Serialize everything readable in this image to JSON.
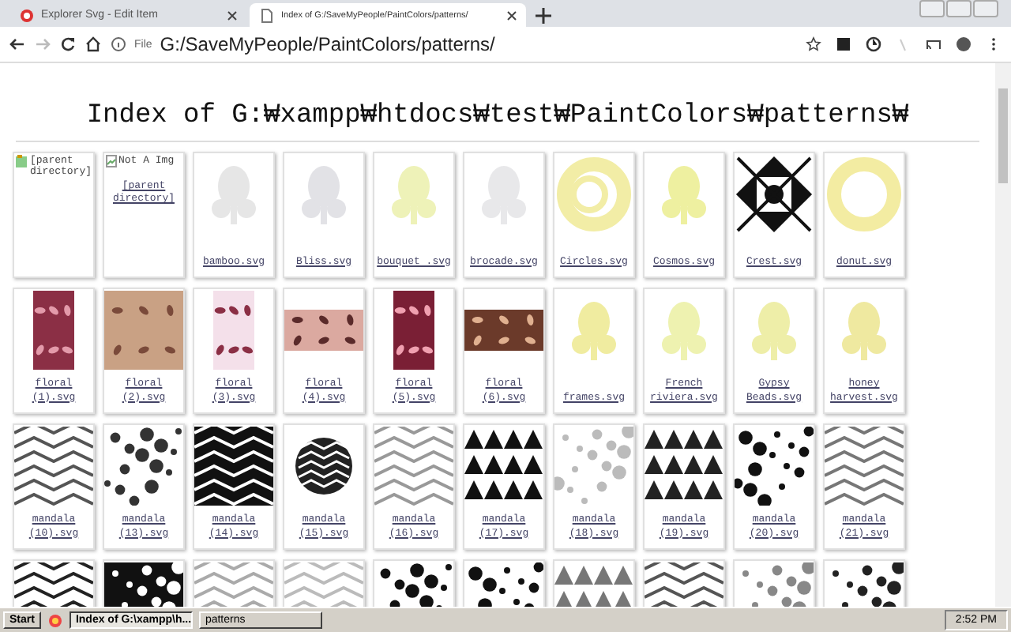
{
  "tabs": [
    {
      "title": "Explorer Svg - Edit Item",
      "selected": false
    },
    {
      "title": "Index of G:/SaveMyPeople/PaintColors/patterns/",
      "selected": true
    }
  ],
  "address_bar": {
    "chip": "File",
    "url": "G:/SaveMyPeople/PaintColors/patterns/"
  },
  "page": {
    "heading": "Index of G:₩xampp₩htdocs₩test₩PaintColors₩patterns₩",
    "items": [
      {
        "kind": "folder",
        "label": "[parent directory]"
      },
      {
        "kind": "broken",
        "alt": "Not A Img",
        "label": "[parent directory]"
      },
      {
        "kind": "file",
        "label": "bamboo.svg"
      },
      {
        "kind": "file",
        "label": "Bliss.svg"
      },
      {
        "kind": "file",
        "label": "bouquet .svg"
      },
      {
        "kind": "file",
        "label": "brocade.svg"
      },
      {
        "kind": "file",
        "label": "Circles.svg"
      },
      {
        "kind": "file",
        "label": "Cosmos.svg"
      },
      {
        "kind": "file",
        "label": "Crest.svg"
      },
      {
        "kind": "file",
        "label": "donut.svg"
      },
      {
        "kind": "file",
        "label": "floral (1).svg"
      },
      {
        "kind": "file",
        "label": "floral (2).svg"
      },
      {
        "kind": "file",
        "label": "floral (3).svg"
      },
      {
        "kind": "file",
        "label": "floral (4).svg"
      },
      {
        "kind": "file",
        "label": "floral (5).svg"
      },
      {
        "kind": "file",
        "label": "floral (6).svg"
      },
      {
        "kind": "file",
        "label": "frames.svg"
      },
      {
        "kind": "file",
        "label": "French riviera.svg"
      },
      {
        "kind": "file",
        "label": "Gypsy Beads.svg"
      },
      {
        "kind": "file",
        "label": "honey harvest.svg"
      },
      {
        "kind": "file",
        "label": "mandala (10).svg"
      },
      {
        "kind": "file",
        "label": "mandala (13).svg"
      },
      {
        "kind": "file",
        "label": "mandala (14).svg"
      },
      {
        "kind": "file",
        "label": "mandala (15).svg"
      },
      {
        "kind": "file",
        "label": "mandala (16).svg"
      },
      {
        "kind": "file",
        "label": "mandala (17).svg"
      },
      {
        "kind": "file",
        "label": "mandala (18).svg"
      },
      {
        "kind": "file",
        "label": "mandala (19).svg"
      },
      {
        "kind": "file",
        "label": "mandala (20).svg"
      },
      {
        "kind": "file",
        "label": "mandala (21).svg"
      },
      {
        "kind": "file"
      },
      {
        "kind": "file"
      },
      {
        "kind": "file"
      },
      {
        "kind": "file"
      },
      {
        "kind": "file"
      },
      {
        "kind": "file"
      },
      {
        "kind": "file"
      },
      {
        "kind": "file"
      },
      {
        "kind": "file"
      },
      {
        "kind": "file"
      }
    ]
  },
  "taskbar": {
    "start": "Start",
    "buttons": [
      {
        "label": "Index of G:\\xampp\\h...",
        "selected": true
      },
      {
        "label": "patterns",
        "selected": false
      }
    ],
    "clock": "2:52 PM"
  }
}
